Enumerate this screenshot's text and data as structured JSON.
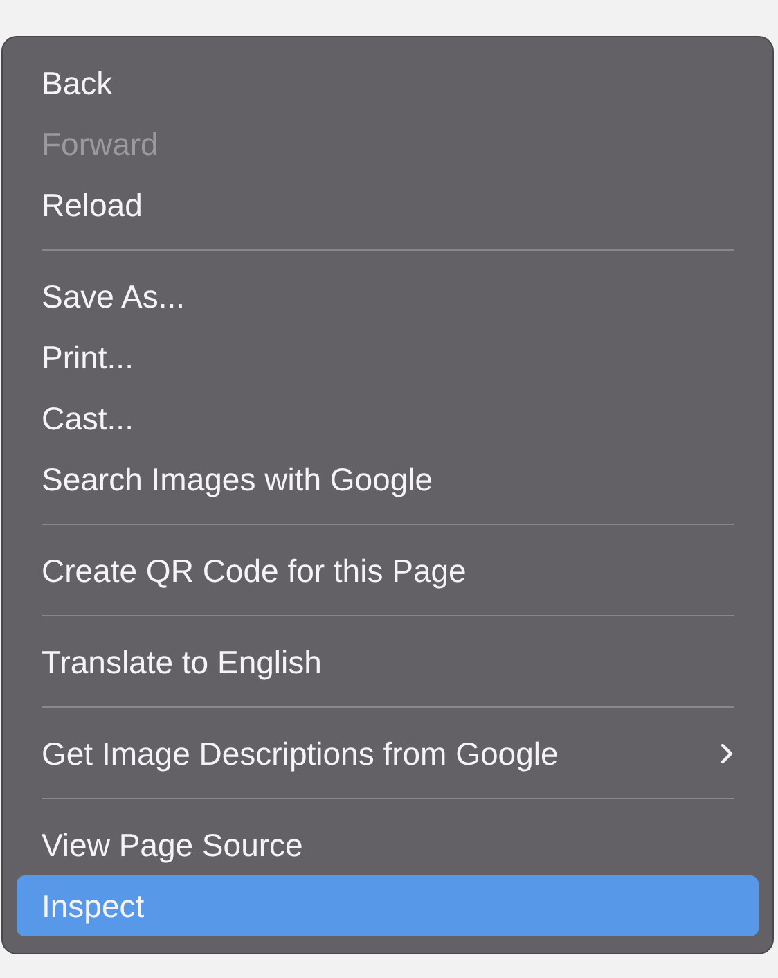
{
  "context_menu": {
    "groups": [
      {
        "items": [
          {
            "label": "Back",
            "disabled": false,
            "selected": false,
            "submenu": false
          },
          {
            "label": "Forward",
            "disabled": true,
            "selected": false,
            "submenu": false
          },
          {
            "label": "Reload",
            "disabled": false,
            "selected": false,
            "submenu": false
          }
        ]
      },
      {
        "items": [
          {
            "label": "Save As...",
            "disabled": false,
            "selected": false,
            "submenu": false
          },
          {
            "label": "Print...",
            "disabled": false,
            "selected": false,
            "submenu": false
          },
          {
            "label": "Cast...",
            "disabled": false,
            "selected": false,
            "submenu": false
          },
          {
            "label": "Search Images with Google",
            "disabled": false,
            "selected": false,
            "submenu": false
          }
        ]
      },
      {
        "items": [
          {
            "label": "Create QR Code for this Page",
            "disabled": false,
            "selected": false,
            "submenu": false
          }
        ]
      },
      {
        "items": [
          {
            "label": "Translate to English",
            "disabled": false,
            "selected": false,
            "submenu": false
          }
        ]
      },
      {
        "items": [
          {
            "label": "Get Image Descriptions from Google",
            "disabled": false,
            "selected": false,
            "submenu": true
          }
        ]
      },
      {
        "items": [
          {
            "label": "View Page Source",
            "disabled": false,
            "selected": false,
            "submenu": false
          },
          {
            "label": "Inspect",
            "disabled": false,
            "selected": true,
            "submenu": false
          }
        ]
      }
    ]
  }
}
